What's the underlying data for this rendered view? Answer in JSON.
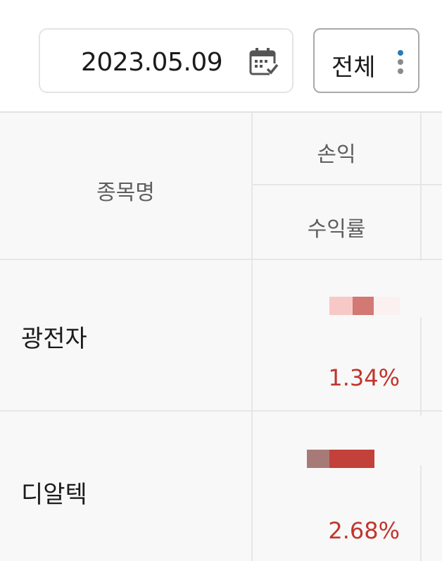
{
  "toolbar": {
    "date_value": "2023.05.09",
    "filter_label": "전체",
    "calendar_icon": "calendar-check-icon",
    "more_icon": "kebab-vertical-icon",
    "accent_color": "#2a7ab8"
  },
  "table": {
    "headers": {
      "name": "종목명",
      "pnl": "손익",
      "return_rate": "수익률"
    },
    "rows": [
      {
        "name": "광전자",
        "return_rate": "1.34%"
      },
      {
        "name": "디알텍",
        "return_rate": "2.68%"
      }
    ],
    "positive_color": "#c0362c"
  }
}
